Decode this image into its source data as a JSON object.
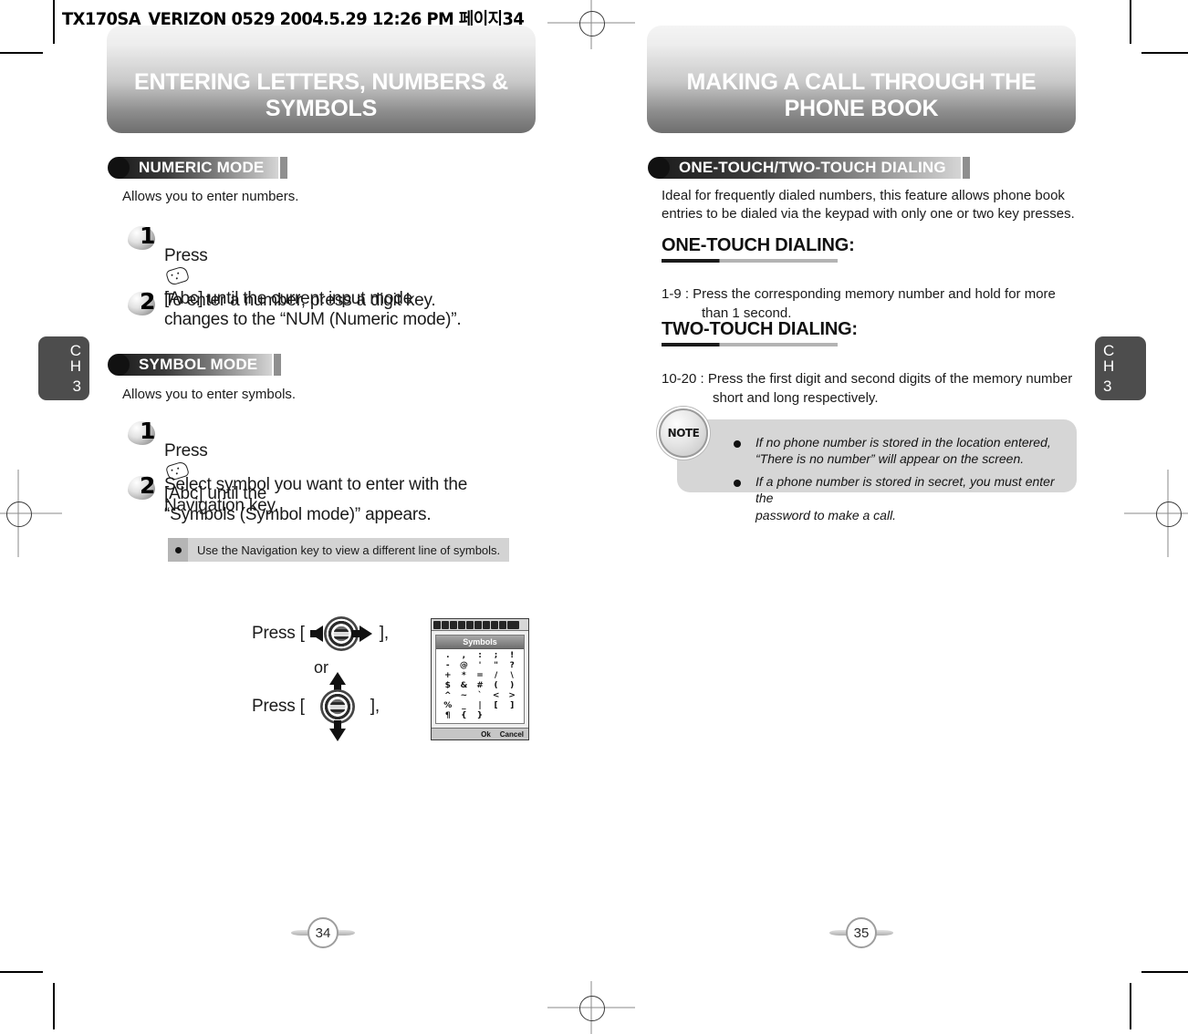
{
  "file_header": "TX170SA_VERIZON 0529  2004.5.29 12:26 PM  페이지34",
  "left_page": {
    "banner_title": "ENTERING LETTERS, NUMBERS & SYMBOLS",
    "chapter_tab": {
      "letters": "C\nH",
      "number": "3"
    },
    "page_number": "34",
    "sections": [
      {
        "heading": "NUMERIC MODE",
        "intro": "Allows you to enter numbers.",
        "steps": [
          {
            "num": "1",
            "text_before": "Press",
            "text_after": "[Abc] until the current input mode\nchanges to the “NUM (Numeric mode)”."
          },
          {
            "num": "2",
            "text_before": "",
            "text_after": "To enter a number, press a digit key."
          }
        ]
      },
      {
        "heading": "SYMBOL MODE",
        "intro": "Allows you to enter symbols.",
        "steps": [
          {
            "num": "1",
            "text_before": "Press",
            "text_after": "[Abc] until the\n“Symbols (Symbol mode)” appears."
          },
          {
            "num": "2",
            "text_before": "",
            "text_after": "Select symbol you want to enter with the\nNavigation key."
          }
        ],
        "tip": "Use the Navigation key to view a different line of symbols."
      }
    ],
    "nav_illustration": {
      "press_label_1": "Press [",
      "close_1": "],",
      "or_label": "or",
      "press_label_2": "Press [",
      "close_2": "],"
    },
    "phone_screen": {
      "title": "Symbols",
      "symbols": [
        ".",
        ",",
        ":",
        ";",
        "!",
        "-",
        "@",
        "'",
        "\"",
        "?",
        "+",
        "*",
        "=",
        "/",
        "\\",
        "$",
        "&",
        "#",
        "(",
        ")",
        "^",
        "~",
        "`",
        "<",
        ">",
        "%",
        "_",
        "|",
        "[",
        "]",
        "¶",
        "{",
        "}",
        "",
        ""
      ],
      "softkey_ok": "Ok",
      "softkey_cancel": "Cancel"
    }
  },
  "right_page": {
    "banner_title": "MAKING A CALL THROUGH THE PHONE BOOK",
    "chapter_tab": {
      "letters": "C\nH",
      "number": "3"
    },
    "page_number": "35",
    "section": {
      "heading": "ONE-TOUCH/TWO-TOUCH DIALING",
      "intro": "Ideal for frequently dialed numbers, this feature allows phone book\nentries to be dialed via the keypad with only one or two key presses."
    },
    "subsections": [
      {
        "title": "ONE-TOUCH DIALING:",
        "lead": "1-9 : Press the corresponding memory number and hold for more",
        "cont": "than 1 second."
      },
      {
        "title": "TWO-TOUCH DIALING:",
        "lead": "10-20 : Press the first digit and second digits of the memory number",
        "cont": "short and long respectively."
      }
    ],
    "note": {
      "badge_label": "NOTE",
      "items": [
        "If no phone number is stored in the location entered,\n“There is no number” will appear on the screen.",
        "If a phone number is stored in secret, you must enter the\npassword to make a call."
      ]
    }
  }
}
